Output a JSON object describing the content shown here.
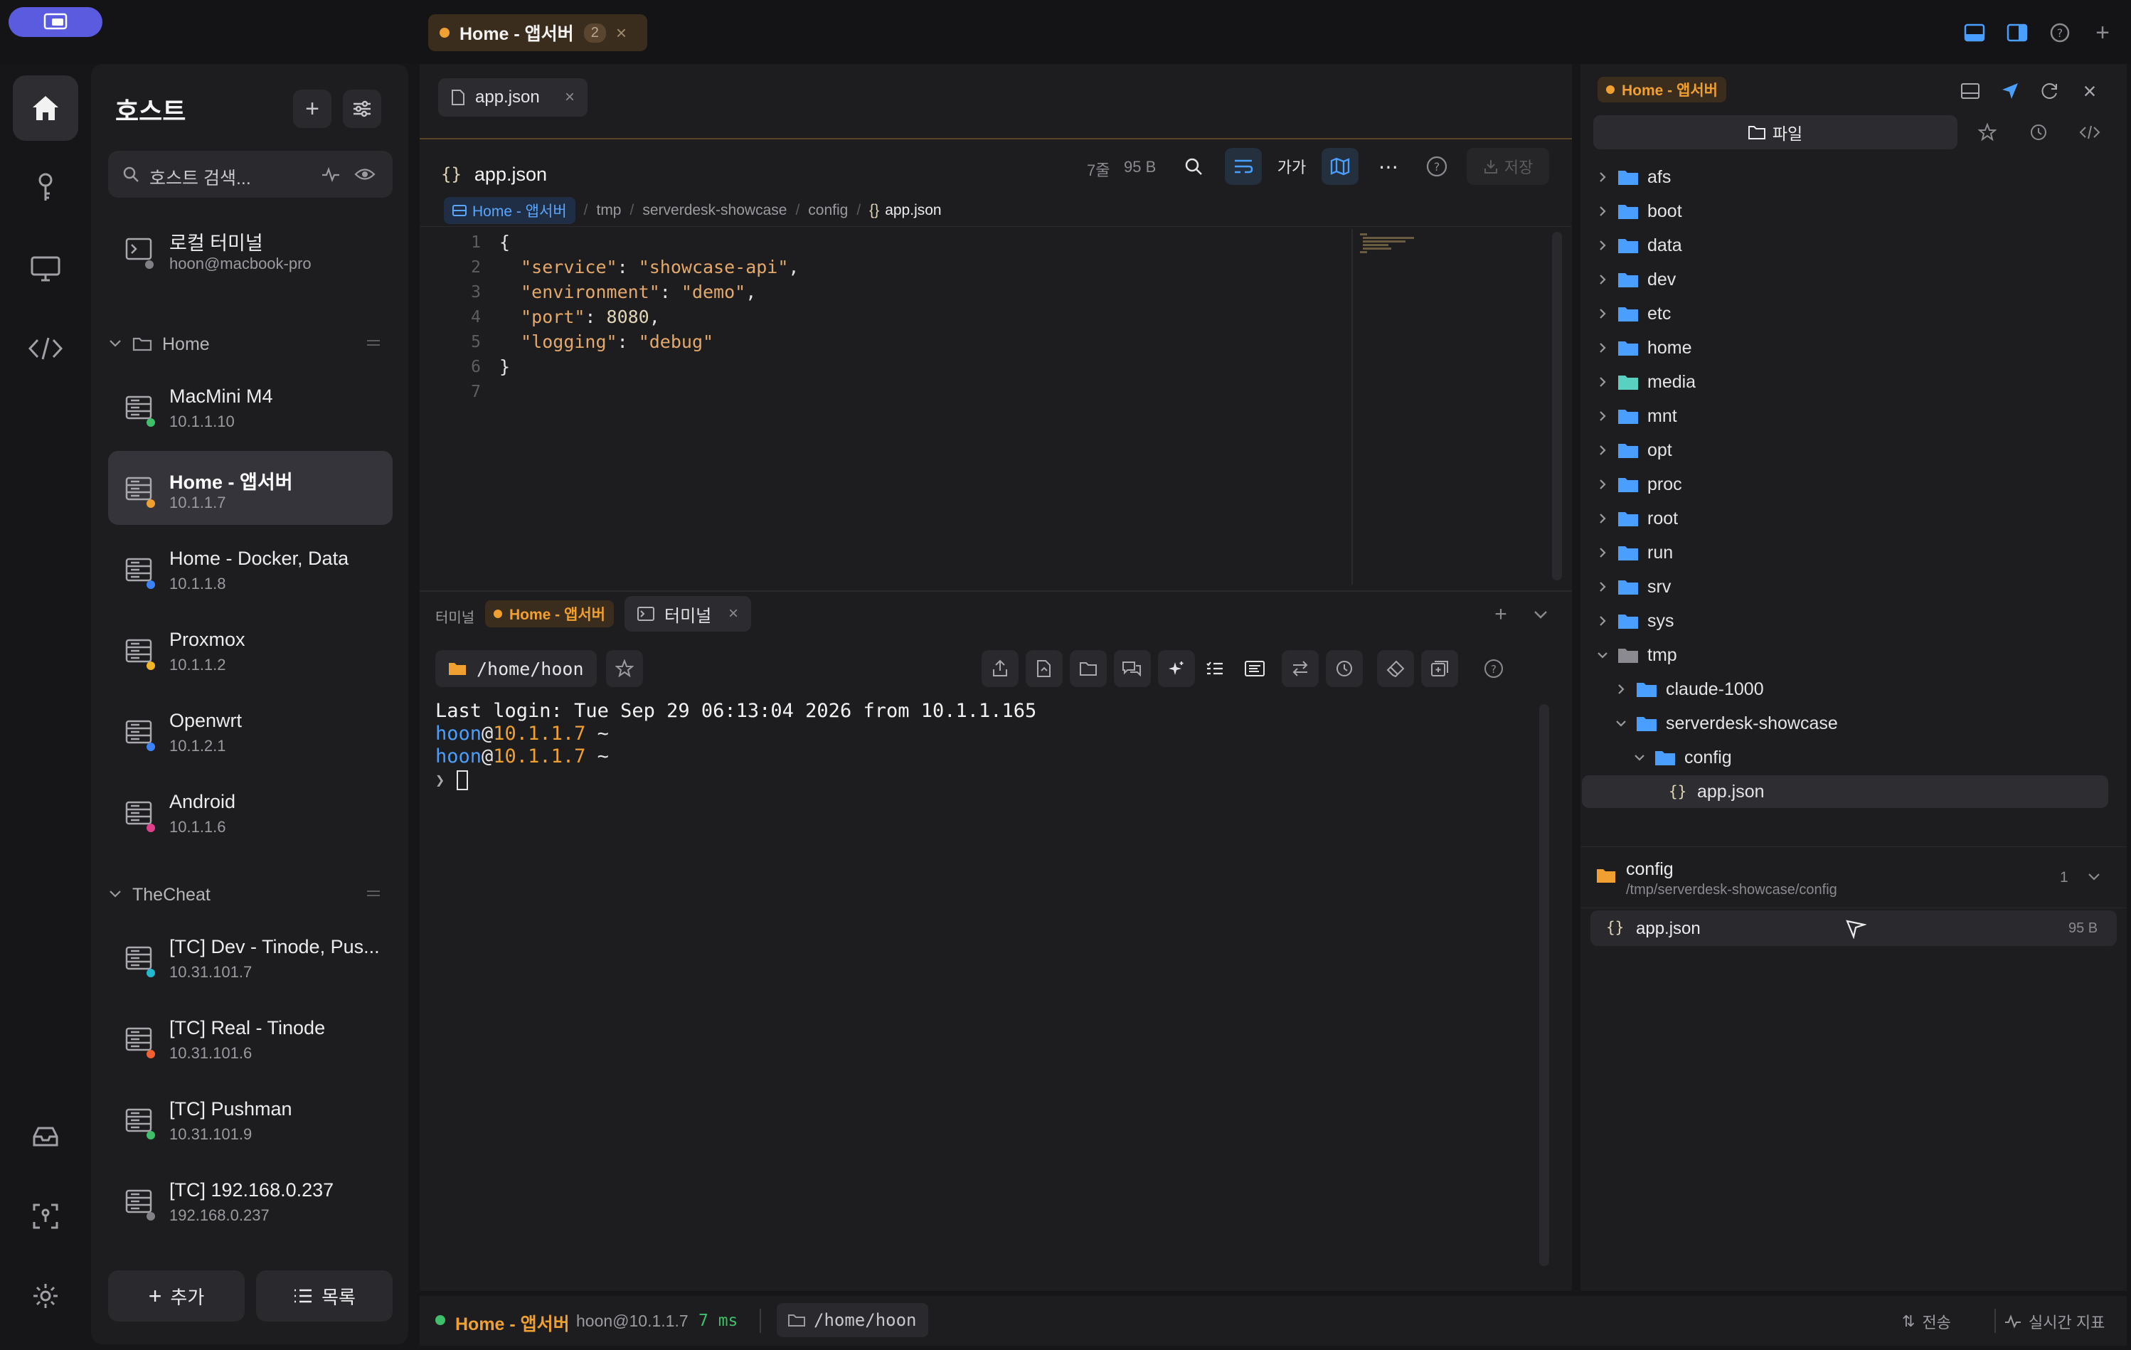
{
  "window": {
    "active_tab": {
      "label": "Home - 앱서버",
      "count": "2"
    }
  },
  "hosts": {
    "title": "호스트",
    "search_placeholder": "호스트 검색...",
    "local": {
      "name": "로컬 터미널",
      "sub": "hoon@macbook-pro"
    },
    "groups": [
      {
        "name": "Home",
        "items": [
          {
            "name": "MacMini M4",
            "ip": "10.1.1.10",
            "status": "#3fbf6a"
          },
          {
            "name": "Home - 앱서버",
            "ip": "10.1.1.7",
            "status": "#f0a030",
            "selected": true
          },
          {
            "name": "Home - Docker, Data",
            "ip": "10.1.1.8",
            "status": "#3b82f6"
          },
          {
            "name": "Proxmox",
            "ip": "10.1.1.2",
            "status": "#f0b429"
          },
          {
            "name": "Openwrt",
            "ip": "10.1.2.1",
            "status": "#3b82f6"
          },
          {
            "name": "Android",
            "ip": "10.1.1.6",
            "status": "#e0408a"
          }
        ]
      },
      {
        "name": "TheCheat",
        "items": [
          {
            "name": "[TC] Dev - Tinode, Pus...",
            "ip": "10.31.101.7",
            "status": "#22b8cf"
          },
          {
            "name": "[TC] Real - Tinode",
            "ip": "10.31.101.6",
            "status": "#f06030"
          },
          {
            "name": "[TC] Pushman",
            "ip": "10.31.101.9",
            "status": "#3fbf6a"
          },
          {
            "name": "[TC] 192.168.0.237",
            "ip": "192.168.0.237",
            "status": "#808086"
          }
        ]
      }
    ],
    "add_label": "추가",
    "list_label": "목록"
  },
  "editor": {
    "tab_label": "app.json",
    "file_name": "app.json",
    "meta_lines": "7줄",
    "meta_size": "95 B",
    "font_toggle": "가가",
    "save_label": "저장",
    "breadcrumb": [
      "Home - 앱서버",
      "tmp",
      "serverdesk-showcase",
      "config",
      "app.json"
    ],
    "code": [
      {
        "n": "1",
        "parts": [
          [
            "p",
            "{"
          ]
        ]
      },
      {
        "n": "2",
        "parts": [
          [
            "p",
            "  "
          ],
          [
            "k",
            "\"service\""
          ],
          [
            "p",
            ": "
          ],
          [
            "s",
            "\"showcase-api\""
          ],
          [
            "p",
            ","
          ]
        ]
      },
      {
        "n": "3",
        "parts": [
          [
            "p",
            "  "
          ],
          [
            "k",
            "\"environment\""
          ],
          [
            "p",
            ": "
          ],
          [
            "s",
            "\"demo\""
          ],
          [
            "p",
            ","
          ]
        ]
      },
      {
        "n": "4",
        "parts": [
          [
            "p",
            "  "
          ],
          [
            "k",
            "\"port\""
          ],
          [
            "p",
            ": "
          ],
          [
            "n",
            "8080"
          ],
          [
            "p",
            ","
          ]
        ]
      },
      {
        "n": "5",
        "parts": [
          [
            "p",
            "  "
          ],
          [
            "k",
            "\"logging\""
          ],
          [
            "p",
            ": "
          ],
          [
            "s",
            "\"debug\""
          ]
        ]
      },
      {
        "n": "6",
        "parts": [
          [
            "p",
            "}"
          ]
        ]
      },
      {
        "n": "7",
        "parts": []
      }
    ]
  },
  "terminal": {
    "section_label": "터미널",
    "host_badge": "Home - 앱서버",
    "tab_label": "터미널",
    "cwd": "/home/hoon",
    "lines": {
      "login": "Last login: Tue Sep 29 06:13:04 2026 from 10.1.1.165",
      "user": "hoon",
      "at": "@",
      "host": "10.1.1.7",
      "tilde": " ~",
      "prompt": "❯"
    }
  },
  "files": {
    "host_badge": "Home - 앱서버",
    "files_tab": "파일",
    "tree": [
      {
        "name": "afs",
        "depth": 0,
        "type": "folder",
        "open": false
      },
      {
        "name": "boot",
        "depth": 0,
        "type": "folder",
        "open": false
      },
      {
        "name": "data",
        "depth": 0,
        "type": "folder",
        "open": false
      },
      {
        "name": "dev",
        "depth": 0,
        "type": "folder",
        "open": false
      },
      {
        "name": "etc",
        "depth": 0,
        "type": "folder",
        "open": false
      },
      {
        "name": "home",
        "depth": 0,
        "type": "folder",
        "open": false
      },
      {
        "name": "media",
        "depth": 0,
        "type": "folder-green",
        "open": false
      },
      {
        "name": "mnt",
        "depth": 0,
        "type": "folder",
        "open": false
      },
      {
        "name": "opt",
        "depth": 0,
        "type": "folder",
        "open": false
      },
      {
        "name": "proc",
        "depth": 0,
        "type": "folder",
        "open": false
      },
      {
        "name": "root",
        "depth": 0,
        "type": "folder",
        "open": false
      },
      {
        "name": "run",
        "depth": 0,
        "type": "folder",
        "open": false
      },
      {
        "name": "srv",
        "depth": 0,
        "type": "folder",
        "open": false
      },
      {
        "name": "sys",
        "depth": 0,
        "type": "folder",
        "open": false
      },
      {
        "name": "tmp",
        "depth": 0,
        "type": "folder-gray",
        "open": true
      },
      {
        "name": "claude-1000",
        "depth": 1,
        "type": "folder",
        "open": false
      },
      {
        "name": "serverdesk-showcase",
        "depth": 1,
        "type": "folder",
        "open": true
      },
      {
        "name": "config",
        "depth": 2,
        "type": "folder",
        "open": true
      },
      {
        "name": "app.json",
        "depth": 3,
        "type": "json",
        "selected": true
      }
    ],
    "folder_summary": {
      "name": "config",
      "path": "/tmp/serverdesk-showcase/config",
      "count": "1"
    },
    "file_item": {
      "name": "app.json",
      "size": "95 B"
    }
  },
  "status": {
    "host": "Home - 앱서버",
    "user": "hoon@10.1.1.7",
    "latency": "7 ms",
    "cwd": "/home/hoon",
    "transfer": "전송",
    "realtime": "실시간 지표"
  },
  "colors": {
    "accent": "#f0a030",
    "blue": "#4a9eff",
    "panel": "#1d1d1f"
  }
}
